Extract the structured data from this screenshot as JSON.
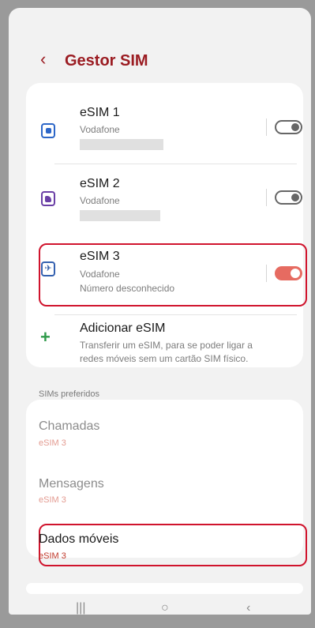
{
  "header": {
    "back_icon": "‹",
    "title": "Gestor SIM"
  },
  "sims": [
    {
      "name": "eSIM 1",
      "carrier": "Vodafone",
      "toggle": "off",
      "icon": "sim-card-icon"
    },
    {
      "name": "eSIM 2",
      "carrier": "Vodafone",
      "toggle": "off",
      "icon": "sim-card-icon"
    },
    {
      "name": "eSIM 3",
      "carrier": "Vodafone",
      "status": "Número desconhecido",
      "toggle": "on",
      "icon": "airplane-icon"
    }
  ],
  "add_esim": {
    "title": "Adicionar eSIM",
    "description_line1": "Transferir um eSIM, para se poder ligar a",
    "description_line2": "redes móveis sem um cartão SIM físico."
  },
  "preferred": {
    "section_label": "SIMs preferidos",
    "items": [
      {
        "title": "Chamadas",
        "value": "eSIM 3"
      },
      {
        "title": "Mensagens",
        "value": "eSIM 3"
      },
      {
        "title": "Dados móveis",
        "value": "eSIM 3"
      }
    ]
  },
  "nav": {
    "recent": "|||",
    "home": "○",
    "back": "‹"
  },
  "colors": {
    "accent": "#9b1c22",
    "highlight": "#d0142d",
    "toggle_on": "#e66b61"
  }
}
